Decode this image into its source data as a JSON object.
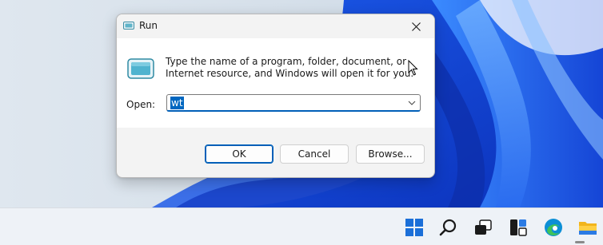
{
  "dialog": {
    "title": "Run",
    "close_icon": "close-icon",
    "description": "Type the name of a program, folder, document, or Internet resource, and Windows will open it for you.",
    "open_label": "Open:",
    "open_value": "wt",
    "buttons": {
      "ok": "OK",
      "cancel": "Cancel",
      "browse": "Browse..."
    }
  },
  "taskbar": {
    "icons": [
      "start-icon",
      "search-icon",
      "task-view-icon",
      "widgets-icon",
      "edge-icon",
      "file-explorer-icon"
    ]
  },
  "colors": {
    "accent": "#005fb8",
    "selection": "#0067c0",
    "dialog_bg": "#f3f3f3",
    "taskbar_bg": "#eef2f7"
  }
}
